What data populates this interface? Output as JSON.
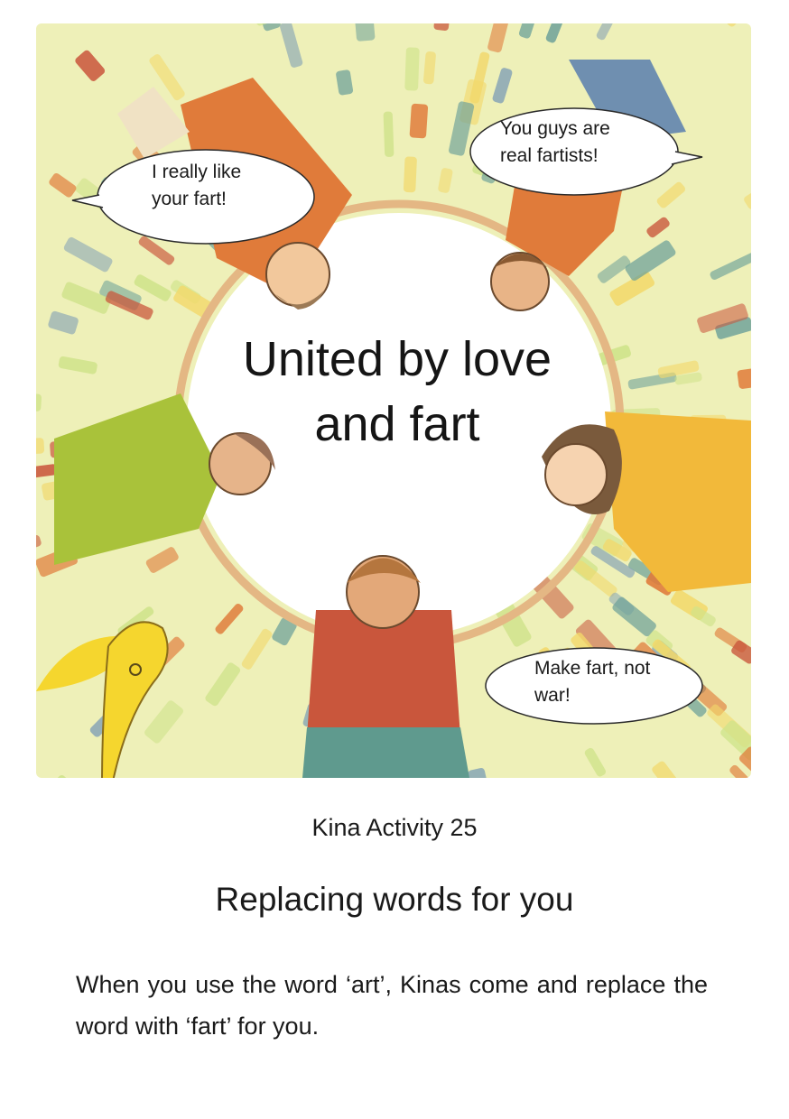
{
  "illustration": {
    "cover_title": "United by love and fart",
    "bubbles": [
      {
        "id": "top-left",
        "text": "I really like your fart!"
      },
      {
        "id": "top-right",
        "text": "You guys are real fartists!"
      },
      {
        "id": "bottom-right",
        "text": "Make fart, not war!"
      }
    ],
    "colors": {
      "warm_yellow": "#f2d86a",
      "light_green": "#cfe38a",
      "blue_gray": "#8aa7b5",
      "teal": "#6fa29a",
      "orange": "#e07b3a",
      "brick_red": "#c9563c",
      "skin": "#e9b98a",
      "mascot_yellow": "#f5d62e"
    }
  },
  "activity": {
    "label": "Kina Activity 25",
    "title": "Replacing words for you",
    "body": "When you use the word ‘art’, Kinas come and replace the word with ‘fart’ for you."
  }
}
